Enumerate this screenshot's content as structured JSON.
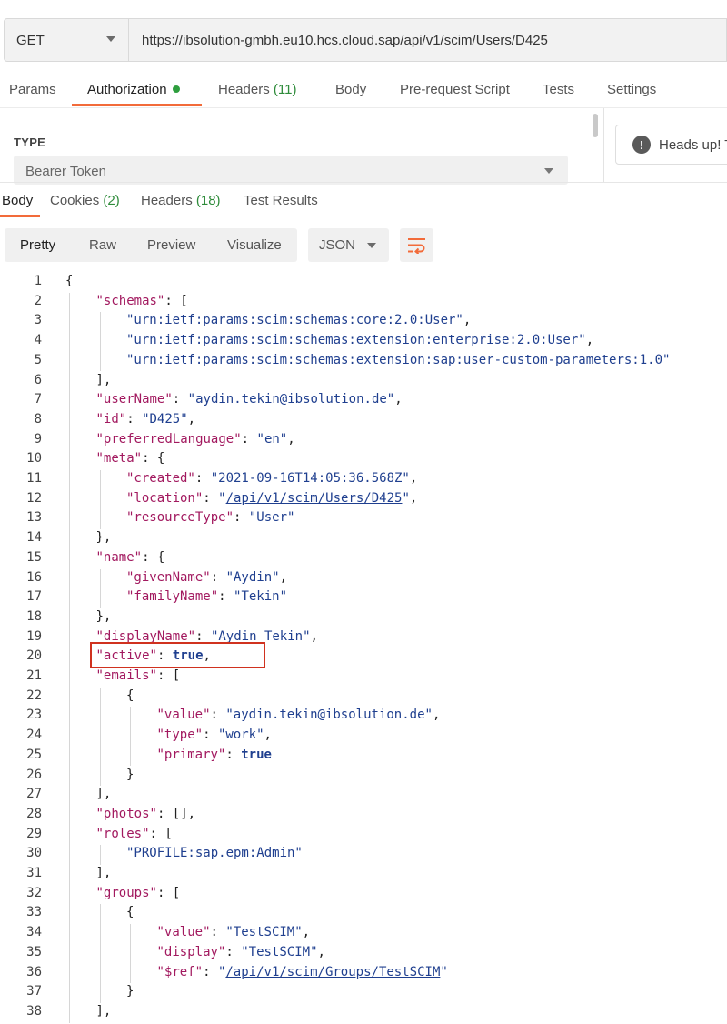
{
  "request": {
    "method": "GET",
    "url": "https://ibsolution-gmbh.eu10.hcs.cloud.sap/api/v1/scim/Users/D425"
  },
  "request_tabs": {
    "params": "Params",
    "authorization": "Authorization",
    "headers": "Headers",
    "headers_count": "(11)",
    "body": "Body",
    "prerequest": "Pre-request Script",
    "tests": "Tests",
    "settings": "Settings"
  },
  "auth": {
    "type_label": "TYPE",
    "type_value": "Bearer Token",
    "notice": "Heads up! T"
  },
  "response_tabs": {
    "body": "Body",
    "cookies": "Cookies",
    "cookies_count": "(2)",
    "headers": "Headers",
    "headers_count": "(18)",
    "test_results": "Test Results"
  },
  "view_toolbar": {
    "pretty": "Pretty",
    "raw": "Raw",
    "preview": "Preview",
    "visualize": "Visualize",
    "format": "JSON"
  },
  "colors": {
    "accent": "#f26b3a",
    "count_green": "#2e8b3a",
    "json_key": "#a2195f",
    "json_value": "#1f3f8f",
    "highlight_box": "#d0321f"
  },
  "code_lines": [
    [
      [
        "p",
        "{"
      ]
    ],
    [
      [
        "key",
        "\"schemas\""
      ],
      [
        "p",
        ": ["
      ]
    ],
    [
      [
        "str",
        "\"urn:ietf:params:scim:schemas:core:2.0:User\""
      ],
      [
        "p",
        ","
      ]
    ],
    [
      [
        "str",
        "\"urn:ietf:params:scim:schemas:extension:enterprise:2.0:User\""
      ],
      [
        "p",
        ","
      ]
    ],
    [
      [
        "str",
        "\"urn:ietf:params:scim:schemas:extension:sap:user-custom-parameters:1.0\""
      ]
    ],
    [
      [
        "p",
        "],"
      ]
    ],
    [
      [
        "key",
        "\"userName\""
      ],
      [
        "p",
        ": "
      ],
      [
        "str",
        "\"aydin.tekin@ibsolution.de\""
      ],
      [
        "p",
        ","
      ]
    ],
    [
      [
        "key",
        "\"id\""
      ],
      [
        "p",
        ": "
      ],
      [
        "str",
        "\"D425\""
      ],
      [
        "p",
        ","
      ]
    ],
    [
      [
        "key",
        "\"preferredLanguage\""
      ],
      [
        "p",
        ": "
      ],
      [
        "str",
        "\"en\""
      ],
      [
        "p",
        ","
      ]
    ],
    [
      [
        "key",
        "\"meta\""
      ],
      [
        "p",
        ": {"
      ]
    ],
    [
      [
        "key",
        "\"created\""
      ],
      [
        "p",
        ": "
      ],
      [
        "str",
        "\"2021-09-16T14:05:36.568Z\""
      ],
      [
        "p",
        ","
      ]
    ],
    [
      [
        "key",
        "\"location\""
      ],
      [
        "p",
        ": "
      ],
      [
        "str",
        "\""
      ],
      [
        "url",
        "/api/v1/scim/Users/D425"
      ],
      [
        "str",
        "\""
      ],
      [
        "p",
        ","
      ]
    ],
    [
      [
        "key",
        "\"resourceType\""
      ],
      [
        "p",
        ": "
      ],
      [
        "str",
        "\"User\""
      ]
    ],
    [
      [
        "p",
        "},"
      ]
    ],
    [
      [
        "key",
        "\"name\""
      ],
      [
        "p",
        ": {"
      ]
    ],
    [
      [
        "key",
        "\"givenName\""
      ],
      [
        "p",
        ": "
      ],
      [
        "str",
        "\"Aydin\""
      ],
      [
        "p",
        ","
      ]
    ],
    [
      [
        "key",
        "\"familyName\""
      ],
      [
        "p",
        ": "
      ],
      [
        "str",
        "\"Tekin\""
      ]
    ],
    [
      [
        "p",
        "},"
      ]
    ],
    [
      [
        "key",
        "\"displayName\""
      ],
      [
        "p",
        ": "
      ],
      [
        "str",
        "\"Aydin Tekin\""
      ],
      [
        "p",
        ","
      ]
    ],
    [
      [
        "key",
        "\"active\""
      ],
      [
        "p",
        ": "
      ],
      [
        "kw",
        "true"
      ],
      [
        "p",
        ","
      ]
    ],
    [
      [
        "key",
        "\"emails\""
      ],
      [
        "p",
        ": ["
      ]
    ],
    [
      [
        "p",
        "{"
      ]
    ],
    [
      [
        "key",
        "\"value\""
      ],
      [
        "p",
        ": "
      ],
      [
        "str",
        "\"aydin.tekin@ibsolution.de\""
      ],
      [
        "p",
        ","
      ]
    ],
    [
      [
        "key",
        "\"type\""
      ],
      [
        "p",
        ": "
      ],
      [
        "str",
        "\"work\""
      ],
      [
        "p",
        ","
      ]
    ],
    [
      [
        "key",
        "\"primary\""
      ],
      [
        "p",
        ": "
      ],
      [
        "kw",
        "true"
      ]
    ],
    [
      [
        "p",
        "}"
      ]
    ],
    [
      [
        "p",
        "],"
      ]
    ],
    [
      [
        "key",
        "\"photos\""
      ],
      [
        "p",
        ": [],"
      ]
    ],
    [
      [
        "key",
        "\"roles\""
      ],
      [
        "p",
        ": ["
      ]
    ],
    [
      [
        "str",
        "\"PROFILE:sap.epm:Admin\""
      ]
    ],
    [
      [
        "p",
        "],"
      ]
    ],
    [
      [
        "key",
        "\"groups\""
      ],
      [
        "p",
        ": ["
      ]
    ],
    [
      [
        "p",
        "{"
      ]
    ],
    [
      [
        "key",
        "\"value\""
      ],
      [
        "p",
        ": "
      ],
      [
        "str",
        "\"TestSCIM\""
      ],
      [
        "p",
        ","
      ]
    ],
    [
      [
        "key",
        "\"display\""
      ],
      [
        "p",
        ": "
      ],
      [
        "str",
        "\"TestSCIM\""
      ],
      [
        "p",
        ","
      ]
    ],
    [
      [
        "key",
        "\"$ref\""
      ],
      [
        "p",
        ": "
      ],
      [
        "str",
        "\""
      ],
      [
        "url",
        "/api/v1/scim/Groups/TestSCIM"
      ],
      [
        "str",
        "\""
      ]
    ],
    [
      [
        "p",
        "}"
      ]
    ],
    [
      [
        "p",
        "],"
      ]
    ]
  ]
}
